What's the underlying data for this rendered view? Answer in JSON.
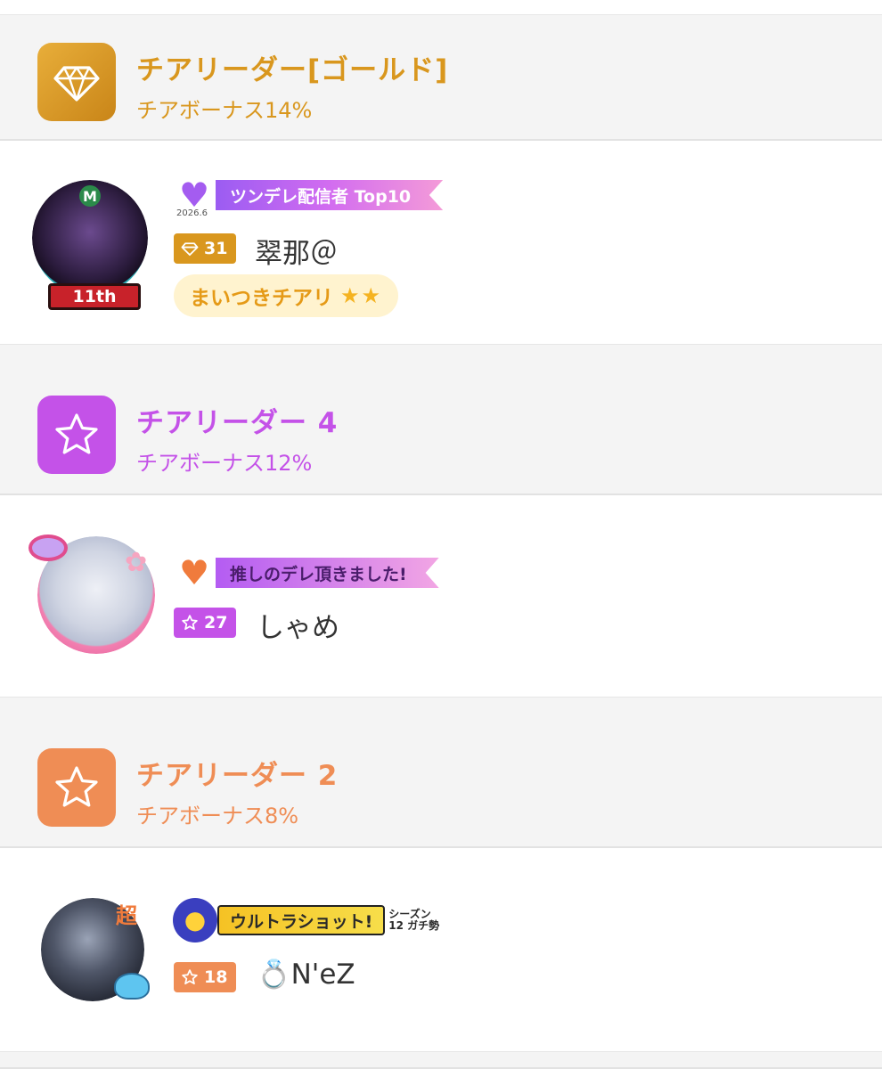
{
  "colors": {
    "gold": "#d9971e",
    "purple": "#c452e8",
    "orange": "#ef8d55",
    "header_bg": "#f4f4f4",
    "pill_bg": "#fff3cf"
  },
  "sections": [
    {
      "icon": "diamond-icon",
      "title": "チアリーダー[ゴールド]",
      "bonus": "チアボーナス14%",
      "user": {
        "frame_text": "11th",
        "frame_letter": "M",
        "banner_text": "ツンデレ配信者 Top10",
        "banner_date": "2026.6",
        "level_icon": "diamond-icon",
        "level": "31",
        "name": "翠那＠",
        "pill_label": "まいつきチアリ",
        "pill_stars": "★★"
      }
    },
    {
      "icon": "star-icon",
      "title": "チアリーダー 4",
      "bonus": "チアボーナス12%",
      "user": {
        "banner_text": "推しのデレ頂きました!",
        "level_icon": "star-icon",
        "level": "27",
        "name": "しゃめ"
      }
    },
    {
      "icon": "star-icon",
      "title": "チアリーダー 2",
      "bonus": "チアボーナス8%",
      "user": {
        "frame_text": "超",
        "banner_text": "ウルトラショット!",
        "banner_sub": "シーズン12 ガチ勢",
        "level_icon": "star-icon",
        "level": "18",
        "name_prefix": "💍",
        "name": "N'eZ"
      }
    }
  ]
}
